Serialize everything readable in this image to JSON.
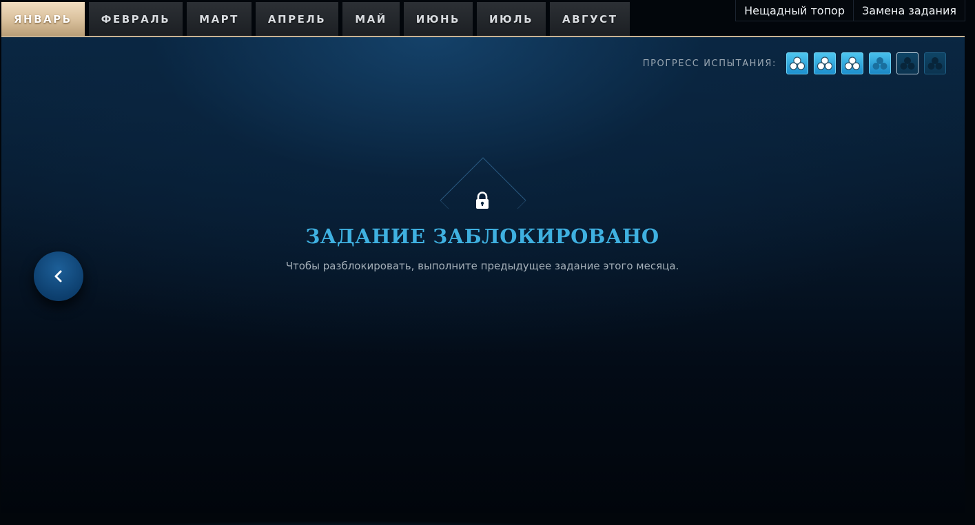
{
  "tabs": [
    {
      "label": "ЯНВАРЬ",
      "active": true
    },
    {
      "label": "ФЕВРАЛЬ",
      "active": false
    },
    {
      "label": "МАРТ",
      "active": false
    },
    {
      "label": "АПРЕЛЬ",
      "active": false
    },
    {
      "label": "МАЙ",
      "active": false
    },
    {
      "label": "ИЮНЬ",
      "active": false
    },
    {
      "label": "ИЮЛЬ",
      "active": false
    },
    {
      "label": "АВГУСТ",
      "active": false
    }
  ],
  "top_options": [
    {
      "label": "Нещадный топор"
    },
    {
      "label": "Замена задания"
    }
  ],
  "progress": {
    "label": "ПРОГРЕСС ИСПЫТАНИЯ:",
    "completed_steps": 3,
    "total_steps": 6,
    "icons": [
      {
        "state": "done",
        "icon": "clover-icon"
      },
      {
        "state": "done",
        "icon": "clover-icon"
      },
      {
        "state": "done",
        "icon": "clover-icon"
      },
      {
        "state": "current",
        "icon": "clover-icon"
      },
      {
        "state": "pending-selected",
        "icon": "clover-icon"
      },
      {
        "state": "pending",
        "icon": "clover-icon"
      }
    ]
  },
  "locked": {
    "title": "ЗАДАНИЕ ЗАБЛОКИРОВАНО",
    "description": "Чтобы разблокировать, выполните предыдущее задание этого месяца.",
    "icon": "lock-icon"
  },
  "back_button": {
    "icon": "chevron-left-icon"
  },
  "colors": {
    "accent_blue": "#3fb0e0",
    "tab_active": "#d8bf9b",
    "panel_border": "#c9b393"
  }
}
